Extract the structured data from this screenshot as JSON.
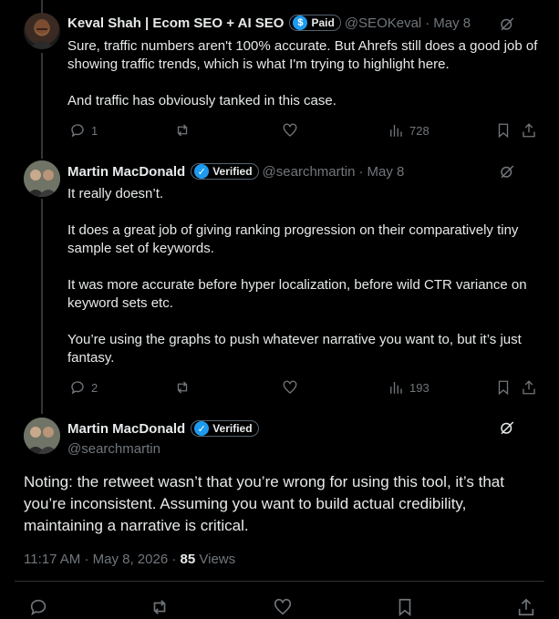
{
  "tweets": [
    {
      "name": "Keval Shah | Ecom SEO + AI SEO",
      "badge": {
        "label": "Paid",
        "icon": "dollar-icon",
        "color": "#1d9bf0"
      },
      "handle": "@SEOKeval",
      "sep": "·",
      "date": "May 8",
      "paragraphs": [
        "Sure, traffic numbers aren't 100% accurate. But Ahrefs still does a good job of showing traffic trends, which is what I'm trying to highlight here.",
        "And traffic has obviously tanked in this case."
      ],
      "replies": "1",
      "views": "728"
    },
    {
      "name": "Martin MacDonald",
      "badge": {
        "label": "Verified",
        "icon": "check-icon",
        "color": "#1d9bf0"
      },
      "handle": "@searchmartin",
      "sep": "·",
      "date": "May 8",
      "paragraphs": [
        "It really doesn’t.",
        "It does a great job of giving ranking progression on their comparatively tiny sample set of keywords.",
        "It was more accurate before hyper localization, before wild CTR variance on keyword sets etc.",
        "You’re using the graphs to push whatever narrative you want to, but it’s just fantasy."
      ],
      "replies": "2",
      "views": "193"
    }
  ],
  "main": {
    "name": "Martin MacDonald",
    "badge": {
      "label": "Verified",
      "icon": "check-icon"
    },
    "handle": "@searchmartin",
    "text": "Noting: the retweet wasn’t that you’re wrong for using this tool, it’s that you’re inconsistent.  Assuming you want to build actual credibility, maintaining a narrative is critical.",
    "time": "11:17 AM",
    "sep1": "·",
    "date": "May 8, 2026",
    "sep2": "·",
    "views_count": "85",
    "views_label": "Views"
  },
  "colors": {
    "background": "#000000",
    "text": "#e7e9ea",
    "muted": "#71767b",
    "accent": "#1d9bf0"
  }
}
